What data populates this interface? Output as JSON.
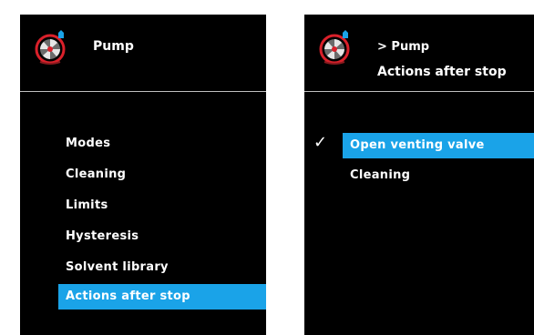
{
  "colors": {
    "background": "#000000",
    "selection": "#1aa3e8",
    "text": "#ffffff",
    "icon_accent": "#d9202a",
    "icon_indicator": "#1aa3e8"
  },
  "left_screen": {
    "icon": "pump-icon",
    "title": "Pump",
    "menu": [
      {
        "label": "Modes"
      },
      {
        "label": "Cleaning"
      },
      {
        "label": "Limits"
      },
      {
        "label": "Hysteresis"
      },
      {
        "label": "Solvent library"
      },
      {
        "label": "Actions after stop",
        "selected": true
      }
    ]
  },
  "right_screen": {
    "icon": "pump-icon",
    "breadcrumb": "> Pump",
    "title": "Actions after stop",
    "options": [
      {
        "label": "Open venting valve",
        "selected": true,
        "checked": true,
        "check_glyph": "✓"
      },
      {
        "label": "Cleaning",
        "selected": false,
        "checked": false
      }
    ]
  }
}
